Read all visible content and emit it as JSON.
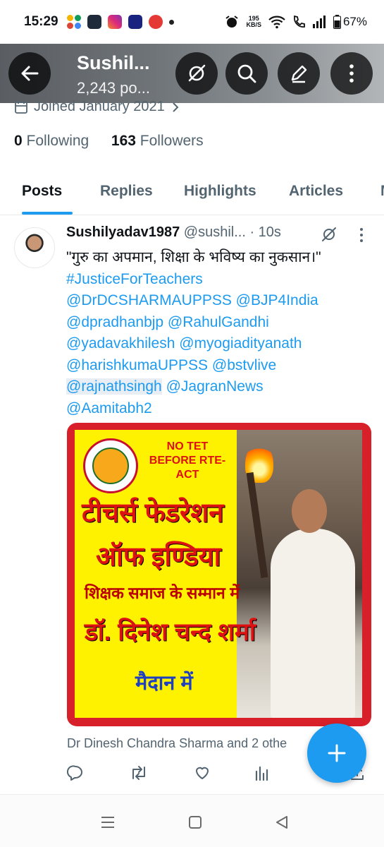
{
  "status_bar": {
    "time": "15:29",
    "net_speed_value": "195",
    "net_speed_unit": "KB/S",
    "battery": "67%"
  },
  "header": {
    "name": "Sushil...",
    "posts_count": "2,243 po..."
  },
  "profile": {
    "joined": "Joined January 2021",
    "following_count": "0",
    "following_label": " Following",
    "followers_count": "163",
    "followers_label": " Followers"
  },
  "tabs": [
    "Posts",
    "Replies",
    "Highlights",
    "Articles",
    "M"
  ],
  "tweet": {
    "display_name": "Sushilyadav1987",
    "meta": " @sushil... · 10s",
    "text": "\"गुरु का अपमान, शिक्षा के भविष्य का नुकसान।\"",
    "hashtag": "#JusticeForTeachers",
    "mentions_line1": "@DrDCSHARMAUPPSS @BJP4India",
    "mentions_line2": "@dpradhanbjp @RahulGandhi",
    "mentions_line3": "@yadavakhilesh @myogiadityanath",
    "mentions_line4": "@harishkumaUPPSS @bstvlive",
    "mention_highlighted": "@rajnathsingh",
    "mention_after": " @JagranNews",
    "mentions_line6": "@Aamitabh2",
    "poster": {
      "no_tet": "NO TET",
      "before_rte": "BEFORE RTE-ACT",
      "line1": "टीचर्स फेडरेशन",
      "line2": "ऑफ इण्डिया",
      "line3": "शिक्षक समाज के सम्मान में",
      "line4": "डॉ. दिनेश चन्द शर्मा",
      "line5": "मैदान में"
    },
    "tagged": "Dr Dinesh Chandra Sharma and 2 othe"
  },
  "colors": {
    "accent": "#1d9bf0",
    "text_primary": "#0f1419",
    "text_secondary": "#536471"
  }
}
